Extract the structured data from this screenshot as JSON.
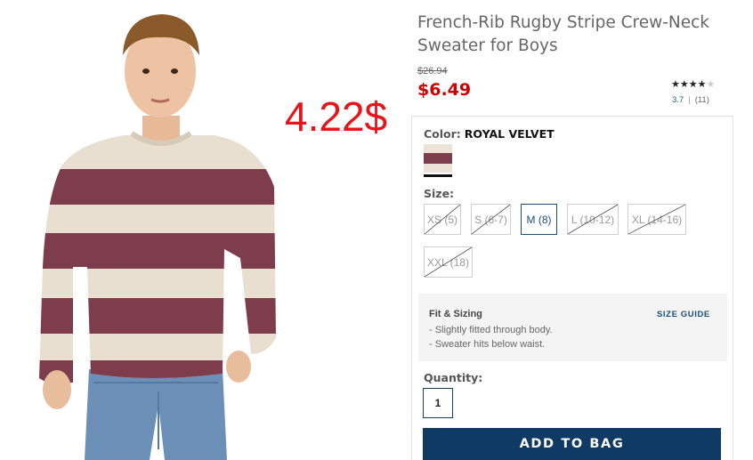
{
  "overlay_price": "4.22$",
  "product": {
    "title": "French-Rib Rugby Stripe Crew-Neck Sweater for Boys",
    "old_price": "$26.94",
    "price": "$6.49",
    "rating": {
      "stars_filled": 4,
      "stars_total": 5,
      "score": "3.7",
      "reviews": "(11)"
    }
  },
  "color": {
    "label": "Color:",
    "value": "ROYAL VELVET",
    "swatch_colors": [
      "#ece3d6",
      "#7d3f4d"
    ]
  },
  "size": {
    "label": "Size:",
    "options": [
      {
        "label": "XS (5)",
        "available": false
      },
      {
        "label": "S (6-7)",
        "available": false
      },
      {
        "label": "M (8)",
        "available": true,
        "selected": true
      },
      {
        "label": "L (10-12)",
        "available": false
      },
      {
        "label": "XL (14-16)",
        "available": false
      },
      {
        "label": "XXL (18)",
        "available": false
      }
    ]
  },
  "fit": {
    "title": "Fit & Sizing",
    "size_guide": "SIZE GUIDE",
    "bullets": [
      "- Slightly fitted through body.",
      "- Sweater hits below waist."
    ]
  },
  "quantity": {
    "label": "Quantity:",
    "value": "1"
  },
  "add_to_bag": "ADD TO BAG",
  "colors": {
    "price_red": "#cc0000",
    "overlay_red": "#e8141b",
    "navy": "#0f3a64",
    "link_blue": "#1e5c8c"
  }
}
